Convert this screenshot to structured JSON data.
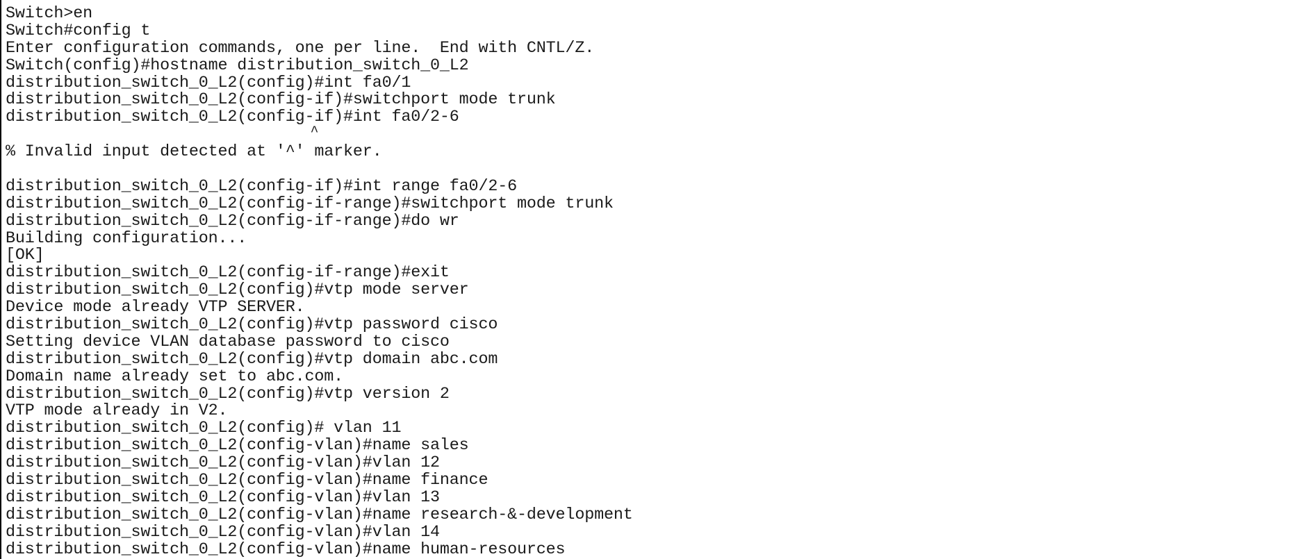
{
  "terminal": {
    "lines": [
      "Switch>en",
      "Switch#config t",
      "Enter configuration commands, one per line.  End with CNTL/Z.",
      "Switch(config)#hostname distribution_switch_0_L2",
      "distribution_switch_0_L2(config)#int fa0/1",
      "distribution_switch_0_L2(config-if)#switchport mode trunk",
      "distribution_switch_0_L2(config-if)#int fa0/2-6",
      "                                     ^",
      "% Invalid input detected at '^' marker.",
      "",
      "distribution_switch_0_L2(config-if)#int range fa0/2-6",
      "distribution_switch_0_L2(config-if-range)#switchport mode trunk",
      "distribution_switch_0_L2(config-if-range)#do wr",
      "Building configuration...",
      "[OK]",
      "distribution_switch_0_L2(config-if-range)#exit",
      "distribution_switch_0_L2(config)#vtp mode server",
      "Device mode already VTP SERVER.",
      "distribution_switch_0_L2(config)#vtp password cisco",
      "Setting device VLAN database password to cisco",
      "distribution_switch_0_L2(config)#vtp domain abc.com",
      "Domain name already set to abc.com.",
      "distribution_switch_0_L2(config)#vtp version 2",
      "VTP mode already in V2.",
      "distribution_switch_0_L2(config)# vlan 11",
      "distribution_switch_0_L2(config-vlan)#name sales",
      "distribution_switch_0_L2(config-vlan)#vlan 12",
      "distribution_switch_0_L2(config-vlan)#name finance",
      "distribution_switch_0_L2(config-vlan)#vlan 13",
      "distribution_switch_0_L2(config-vlan)#name research-&-development",
      "distribution_switch_0_L2(config-vlan)#vlan 14",
      "distribution_switch_0_L2(config-vlan)#name human-resources"
    ]
  }
}
